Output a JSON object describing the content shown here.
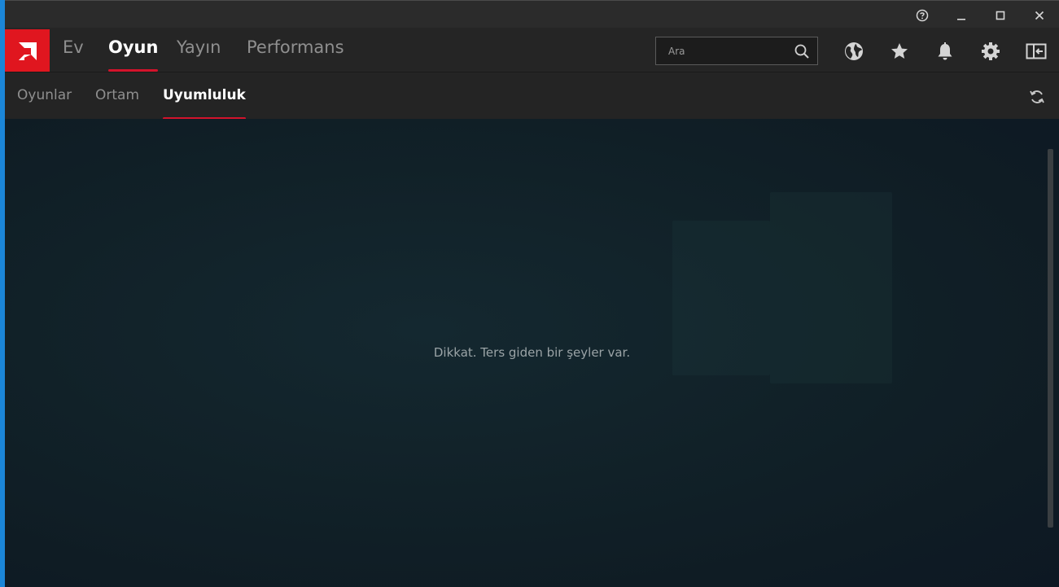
{
  "window": {
    "controls": {
      "help_icon": "help-circle-icon",
      "minimize_icon": "minimize-icon",
      "maximize_icon": "maximize-icon",
      "close_icon": "close-icon"
    }
  },
  "logo": {
    "icon": "amd-logo-icon",
    "color": "#e0161f"
  },
  "nav": {
    "items": [
      {
        "label": "Ev",
        "active": false
      },
      {
        "label": "Oyun",
        "active": true
      },
      {
        "label": "Yayın",
        "active": false
      },
      {
        "label": "Performans",
        "active": false
      }
    ]
  },
  "search": {
    "placeholder": "Ara",
    "value": ""
  },
  "toolbar": {
    "icons": [
      "globe-icon",
      "star-icon",
      "bell-icon",
      "gear-icon",
      "sidebar-toggle-icon"
    ]
  },
  "subnav": {
    "items": [
      {
        "label": "Oyunlar",
        "active": false
      },
      {
        "label": "Ortam",
        "active": false
      },
      {
        "label": "Uyumluluk",
        "active": true
      }
    ],
    "refresh_icon": "refresh-icon"
  },
  "content": {
    "message": "Dikkat. Ters giden bir şeyler var."
  },
  "colors": {
    "accent": "#d3132b",
    "background": "#212121",
    "content_bg": "#112128"
  }
}
